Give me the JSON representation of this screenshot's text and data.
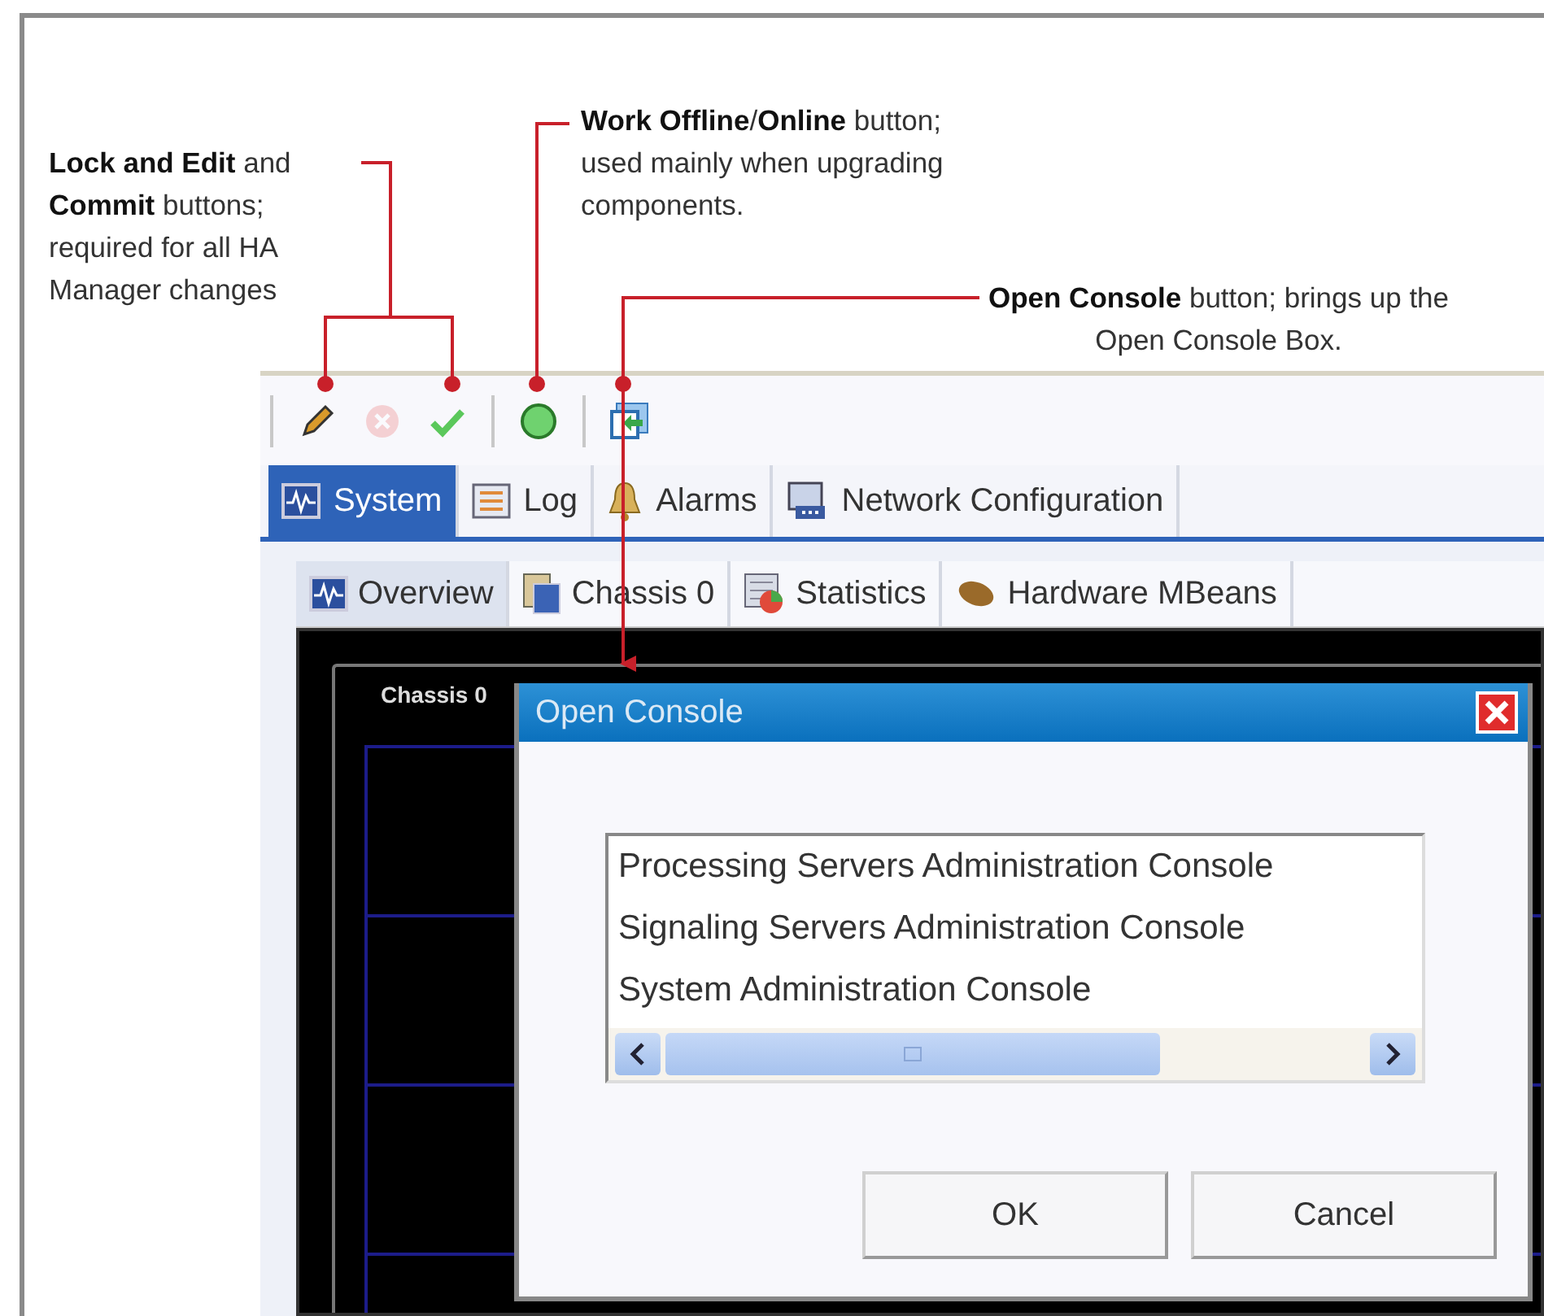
{
  "callouts": [
    {
      "text": "**Lock and Edit** and **Commit** buttons; required for all HA Manager changes"
    },
    {
      "text": "**Work Offline**/**Online** button; used mainly when upgrading components."
    },
    {
      "text": "**Open Console** button; brings up the Open Console Box."
    }
  ],
  "toolbar": {
    "buttons": [
      {
        "kind": "separator"
      },
      {
        "kind": "lock_edit",
        "disabled": false
      },
      {
        "kind": "cancel",
        "disabled": true
      },
      {
        "kind": "commit",
        "disabled": false
      },
      {
        "kind": "separator"
      },
      {
        "kind": "work_offline",
        "disabled": false
      },
      {
        "kind": "separator"
      },
      {
        "kind": "open_console",
        "disabled": false
      }
    ]
  },
  "tabs": [
    {
      "label": "System",
      "kind": "monitor",
      "selected": true
    },
    {
      "label": "Log",
      "kind": "log",
      "selected": false
    },
    {
      "label": "Alarms",
      "kind": "bell",
      "selected": false
    },
    {
      "label": "Network Configuration",
      "kind": "network",
      "selected": false
    }
  ],
  "subtabs": [
    {
      "label": "Overview",
      "kind": "monitor",
      "selected": true
    },
    {
      "label": "Chassis 0",
      "kind": "chassis",
      "selected": false
    },
    {
      "label": "Statistics",
      "kind": "stats",
      "selected": false
    },
    {
      "label": "Hardware MBeans",
      "kind": "bean",
      "selected": false
    }
  ],
  "chassis": {
    "label": "Chassis 0"
  },
  "dialog": {
    "title": "Open Console",
    "items": [
      "Processing Servers Administration Console",
      "Signaling Servers Administration Console",
      "System Administration Console"
    ],
    "buttons": [
      "OK",
      "Cancel"
    ]
  }
}
